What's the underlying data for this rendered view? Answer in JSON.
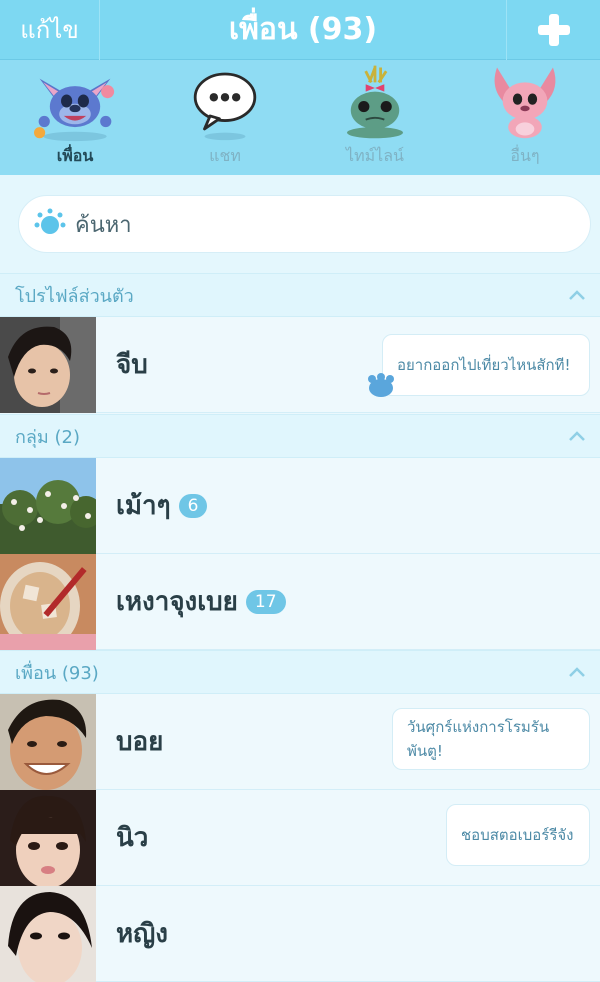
{
  "header": {
    "edit_label": "แก้ไข",
    "title": "เพื่อน (93)"
  },
  "tabs": [
    {
      "label": "เพื่อน",
      "icon": "stitch-icon",
      "active": true
    },
    {
      "label": "แชท",
      "icon": "chat-bubble-icon",
      "active": false
    },
    {
      "label": "ไทม์ไลน์",
      "icon": "scrump-icon",
      "active": false
    },
    {
      "label": "อื่นๆ",
      "icon": "angel-icon",
      "active": false
    }
  ],
  "search": {
    "placeholder": "ค้นหา"
  },
  "sections": {
    "profile": "โปรไฟล์ส่วนตัว",
    "groups": "กลุ่ม (2)",
    "friends": "เพื่อน (93)"
  },
  "profile": {
    "name": "จีบ",
    "status": "อยากออกไปเที่ยวไหนสักที!"
  },
  "groups": [
    {
      "name": "เม้าๆ",
      "count": "6"
    },
    {
      "name": "เหงาจุงเบย",
      "count": "17"
    }
  ],
  "friends": [
    {
      "name": "บอย",
      "status": "วันศุกร์แห่งการโรมรันพันตู!"
    },
    {
      "name": "นิว",
      "status": "ชอบสตอเบอร์รีจัง"
    },
    {
      "name": "หญิง",
      "status": ""
    }
  ],
  "colors": {
    "header": "#7dd8f2",
    "accent": "#6fc6e6",
    "section_text": "#5aa8c4"
  }
}
